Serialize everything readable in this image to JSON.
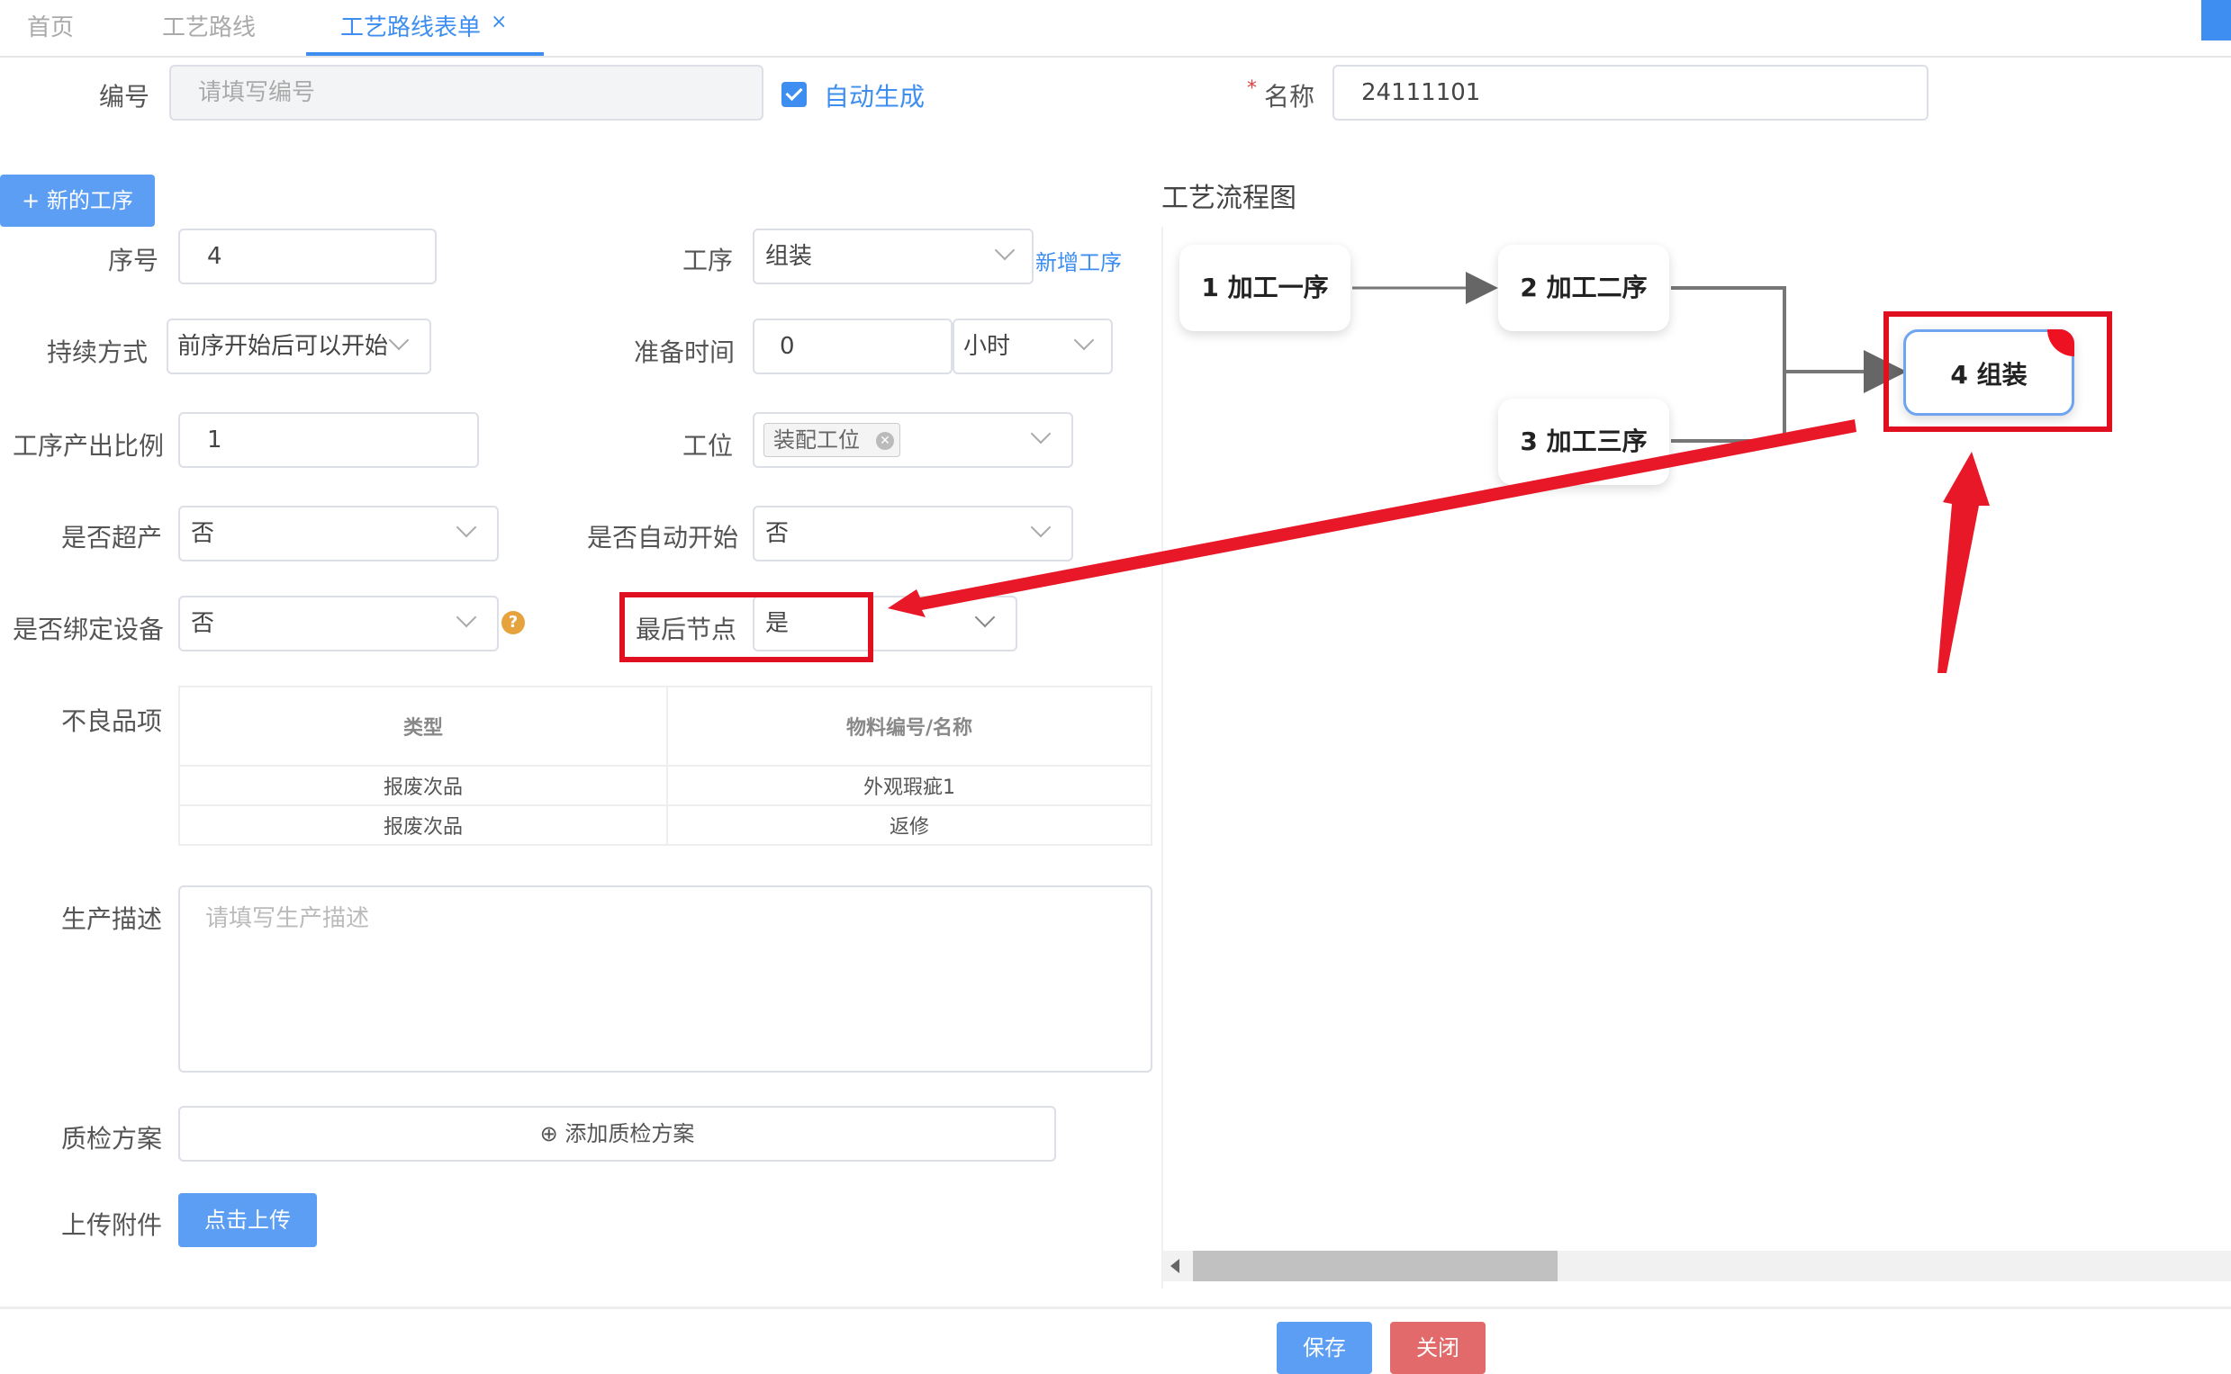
{
  "tabs": [
    {
      "label": "首页"
    },
    {
      "label": "工艺路线"
    },
    {
      "label": "工艺路线表单",
      "close": "×"
    }
  ],
  "header": {
    "code_label": "编号",
    "code_placeholder": "请填写编号",
    "auto_generate_label": "自动生成",
    "name_label": "名称",
    "required_mark": "*",
    "name_value": "24111101"
  },
  "add_process_button": "+ 新的工序",
  "form": {
    "seq_label": "序号",
    "seq_value": "4",
    "process_label": "工序",
    "process_value": "组装",
    "new_process_link": "新增工序",
    "duration_mode_label": "持续方式",
    "duration_mode_value": "前序开始后可以开始",
    "prep_time_label": "准备时间",
    "prep_time_value": "0",
    "prep_time_unit": "小时",
    "output_ratio_label": "工序产出比例",
    "output_ratio_value": "1",
    "station_label": "工位",
    "station_tag": "装配工位",
    "over_production_label": "是否超产",
    "over_production_value": "否",
    "auto_start_label": "是否自动开始",
    "auto_start_value": "否",
    "bind_device_label": "是否绑定设备",
    "bind_device_value": "否",
    "last_node_label": "最后节点",
    "last_node_value": "是",
    "defect_label": "不良品项",
    "defect_table": {
      "headers": [
        "类型",
        "物料编号/名称"
      ],
      "rows": [
        [
          "报废次品",
          "外观瑕疵1"
        ],
        [
          "报废次品",
          "返修"
        ]
      ]
    },
    "description_label": "生产描述",
    "description_placeholder": "请填写生产描述",
    "qc_label": "质检方案",
    "qc_add_button": "添加质检方案",
    "attachment_label": "上传附件",
    "upload_button": "点击上传"
  },
  "flow": {
    "title": "工艺流程图",
    "nodes": [
      {
        "label": "1 加工一序"
      },
      {
        "label": "2 加工二序"
      },
      {
        "label": "3 加工三序"
      },
      {
        "label": "4 组装"
      }
    ]
  },
  "footer": {
    "save_button": "保存",
    "close_button": "关闭"
  },
  "colors": {
    "primary": "#3d8ef0",
    "danger_button": "#e26a6a",
    "annotation_red": "#e01020",
    "warning": "#e5a23d"
  }
}
